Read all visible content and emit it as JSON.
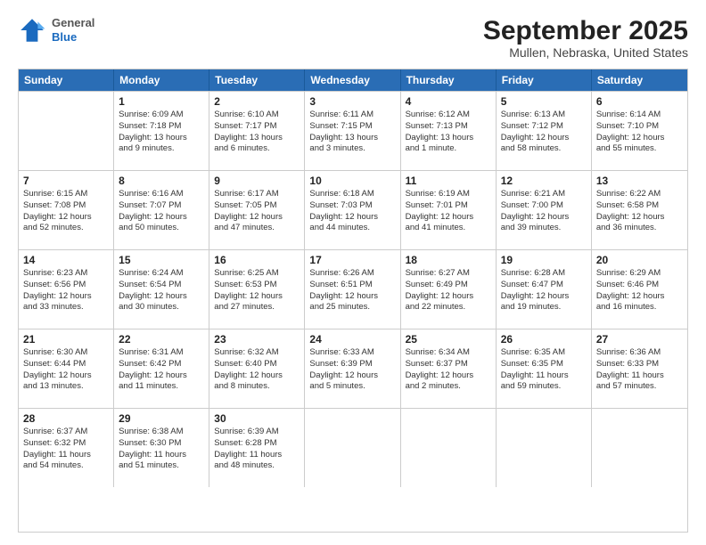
{
  "header": {
    "logo": {
      "general": "General",
      "blue": "Blue"
    },
    "title": "September 2025",
    "subtitle": "Mullen, Nebraska, United States"
  },
  "calendar": {
    "weekdays": [
      "Sunday",
      "Monday",
      "Tuesday",
      "Wednesday",
      "Thursday",
      "Friday",
      "Saturday"
    ],
    "rows": [
      [
        {
          "day": "",
          "info": ""
        },
        {
          "day": "1",
          "info": "Sunrise: 6:09 AM\nSunset: 7:18 PM\nDaylight: 13 hours\nand 9 minutes."
        },
        {
          "day": "2",
          "info": "Sunrise: 6:10 AM\nSunset: 7:17 PM\nDaylight: 13 hours\nand 6 minutes."
        },
        {
          "day": "3",
          "info": "Sunrise: 6:11 AM\nSunset: 7:15 PM\nDaylight: 13 hours\nand 3 minutes."
        },
        {
          "day": "4",
          "info": "Sunrise: 6:12 AM\nSunset: 7:13 PM\nDaylight: 13 hours\nand 1 minute."
        },
        {
          "day": "5",
          "info": "Sunrise: 6:13 AM\nSunset: 7:12 PM\nDaylight: 12 hours\nand 58 minutes."
        },
        {
          "day": "6",
          "info": "Sunrise: 6:14 AM\nSunset: 7:10 PM\nDaylight: 12 hours\nand 55 minutes."
        }
      ],
      [
        {
          "day": "7",
          "info": "Sunrise: 6:15 AM\nSunset: 7:08 PM\nDaylight: 12 hours\nand 52 minutes."
        },
        {
          "day": "8",
          "info": "Sunrise: 6:16 AM\nSunset: 7:07 PM\nDaylight: 12 hours\nand 50 minutes."
        },
        {
          "day": "9",
          "info": "Sunrise: 6:17 AM\nSunset: 7:05 PM\nDaylight: 12 hours\nand 47 minutes."
        },
        {
          "day": "10",
          "info": "Sunrise: 6:18 AM\nSunset: 7:03 PM\nDaylight: 12 hours\nand 44 minutes."
        },
        {
          "day": "11",
          "info": "Sunrise: 6:19 AM\nSunset: 7:01 PM\nDaylight: 12 hours\nand 41 minutes."
        },
        {
          "day": "12",
          "info": "Sunrise: 6:21 AM\nSunset: 7:00 PM\nDaylight: 12 hours\nand 39 minutes."
        },
        {
          "day": "13",
          "info": "Sunrise: 6:22 AM\nSunset: 6:58 PM\nDaylight: 12 hours\nand 36 minutes."
        }
      ],
      [
        {
          "day": "14",
          "info": "Sunrise: 6:23 AM\nSunset: 6:56 PM\nDaylight: 12 hours\nand 33 minutes."
        },
        {
          "day": "15",
          "info": "Sunrise: 6:24 AM\nSunset: 6:54 PM\nDaylight: 12 hours\nand 30 minutes."
        },
        {
          "day": "16",
          "info": "Sunrise: 6:25 AM\nSunset: 6:53 PM\nDaylight: 12 hours\nand 27 minutes."
        },
        {
          "day": "17",
          "info": "Sunrise: 6:26 AM\nSunset: 6:51 PM\nDaylight: 12 hours\nand 25 minutes."
        },
        {
          "day": "18",
          "info": "Sunrise: 6:27 AM\nSunset: 6:49 PM\nDaylight: 12 hours\nand 22 minutes."
        },
        {
          "day": "19",
          "info": "Sunrise: 6:28 AM\nSunset: 6:47 PM\nDaylight: 12 hours\nand 19 minutes."
        },
        {
          "day": "20",
          "info": "Sunrise: 6:29 AM\nSunset: 6:46 PM\nDaylight: 12 hours\nand 16 minutes."
        }
      ],
      [
        {
          "day": "21",
          "info": "Sunrise: 6:30 AM\nSunset: 6:44 PM\nDaylight: 12 hours\nand 13 minutes."
        },
        {
          "day": "22",
          "info": "Sunrise: 6:31 AM\nSunset: 6:42 PM\nDaylight: 12 hours\nand 11 minutes."
        },
        {
          "day": "23",
          "info": "Sunrise: 6:32 AM\nSunset: 6:40 PM\nDaylight: 12 hours\nand 8 minutes."
        },
        {
          "day": "24",
          "info": "Sunrise: 6:33 AM\nSunset: 6:39 PM\nDaylight: 12 hours\nand 5 minutes."
        },
        {
          "day": "25",
          "info": "Sunrise: 6:34 AM\nSunset: 6:37 PM\nDaylight: 12 hours\nand 2 minutes."
        },
        {
          "day": "26",
          "info": "Sunrise: 6:35 AM\nSunset: 6:35 PM\nDaylight: 11 hours\nand 59 minutes."
        },
        {
          "day": "27",
          "info": "Sunrise: 6:36 AM\nSunset: 6:33 PM\nDaylight: 11 hours\nand 57 minutes."
        }
      ],
      [
        {
          "day": "28",
          "info": "Sunrise: 6:37 AM\nSunset: 6:32 PM\nDaylight: 11 hours\nand 54 minutes."
        },
        {
          "day": "29",
          "info": "Sunrise: 6:38 AM\nSunset: 6:30 PM\nDaylight: 11 hours\nand 51 minutes."
        },
        {
          "day": "30",
          "info": "Sunrise: 6:39 AM\nSunset: 6:28 PM\nDaylight: 11 hours\nand 48 minutes."
        },
        {
          "day": "",
          "info": ""
        },
        {
          "day": "",
          "info": ""
        },
        {
          "day": "",
          "info": ""
        },
        {
          "day": "",
          "info": ""
        }
      ]
    ]
  }
}
